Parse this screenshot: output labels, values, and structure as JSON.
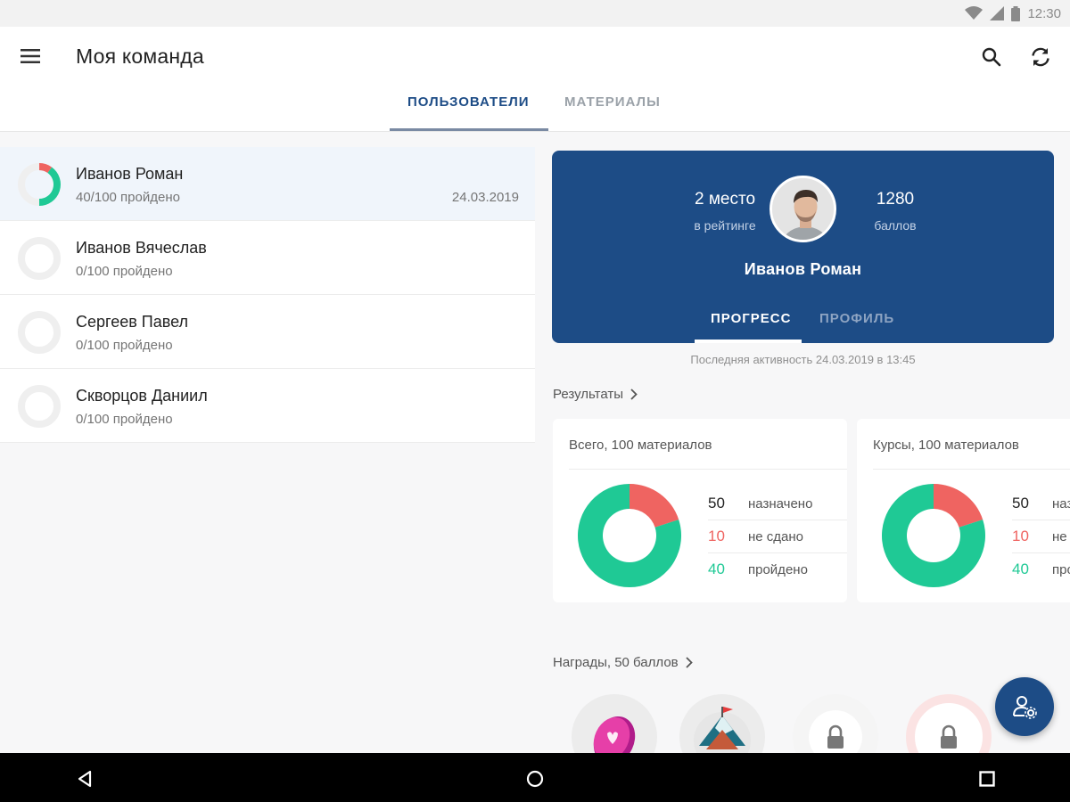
{
  "status_bar": {
    "time": "12:30",
    "icons": [
      "wifi-icon",
      "signal-icon",
      "battery-icon"
    ]
  },
  "app_bar": {
    "title": "Моя команда",
    "icons": {
      "menu": "menu-icon",
      "search": "search-icon",
      "refresh": "refresh-icon"
    }
  },
  "tabs": [
    {
      "label": "ПОЛЬЗОВАТЕЛИ",
      "active": true
    },
    {
      "label": "МАТЕРИАЛЫ",
      "active": false
    }
  ],
  "users": [
    {
      "name": "Иванов Роман",
      "progress_text": "40/100 пройдено",
      "date": "24.03.2019",
      "progress": {
        "passed": 40,
        "failed": 10,
        "total": 100
      },
      "selected": true
    },
    {
      "name": "Иванов Вячеслав",
      "progress_text": "0/100 пройдено",
      "date": "",
      "progress": {
        "passed": 0,
        "failed": 0,
        "total": 100
      },
      "selected": false
    },
    {
      "name": "Сергеев Павел",
      "progress_text": "0/100 пройдено",
      "date": "",
      "progress": {
        "passed": 0,
        "failed": 0,
        "total": 100
      },
      "selected": false
    },
    {
      "name": "Скворцов Даниил",
      "progress_text": "0/100 пройдено",
      "date": "",
      "progress": {
        "passed": 0,
        "failed": 0,
        "total": 100
      },
      "selected": false
    }
  ],
  "profile": {
    "rank_value": "2 место",
    "rank_label": "в рейтинге",
    "points_value": "1280",
    "points_label": "баллов",
    "name": "Иванов Роман",
    "tabs": [
      {
        "label": "ПРОГРЕСС",
        "active": true
      },
      {
        "label": "ПРОФИЛЬ",
        "active": false
      }
    ],
    "last_activity": "Последняя активность 24.03.2019 в 13:45"
  },
  "results": {
    "header": "Результаты",
    "cards": [
      {
        "title": "Всего, 100 материалов",
        "rows": [
          {
            "num": "50",
            "label": "назначено",
            "color": "#222222"
          },
          {
            "num": "10",
            "label": "не сдано",
            "color": "#ef6461"
          },
          {
            "num": "40",
            "label": "пройдено",
            "color": "#1fc995"
          }
        ],
        "donut": {
          "assigned": 50,
          "failed": 10,
          "passed": 40
        }
      },
      {
        "title": "Курсы, 100 материалов",
        "rows": [
          {
            "num": "50",
            "label": "назначено",
            "color": "#222222"
          },
          {
            "num": "10",
            "label": "не сдано",
            "color": "#ef6461"
          },
          {
            "num": "40",
            "label": "пройдено",
            "color": "#1fc995"
          }
        ],
        "donut": {
          "assigned": 50,
          "failed": 10,
          "passed": 40
        }
      }
    ]
  },
  "awards": {
    "header": "Награды, 50 баллов",
    "items": [
      {
        "icon": "coin-award-icon",
        "locked": false
      },
      {
        "icon": "mountain-award-icon",
        "locked": false
      },
      {
        "icon": "lock-icon",
        "locked": true
      },
      {
        "icon": "lock-icon",
        "locked": true
      }
    ]
  },
  "fab": {
    "icon": "user-settings-icon"
  },
  "colors": {
    "primary": "#1d4c86",
    "passed": "#1fc995",
    "failed": "#ef6461",
    "track": "#efefef"
  },
  "nav_bar": {
    "icons": [
      "back-icon",
      "home-icon",
      "recents-icon"
    ]
  }
}
